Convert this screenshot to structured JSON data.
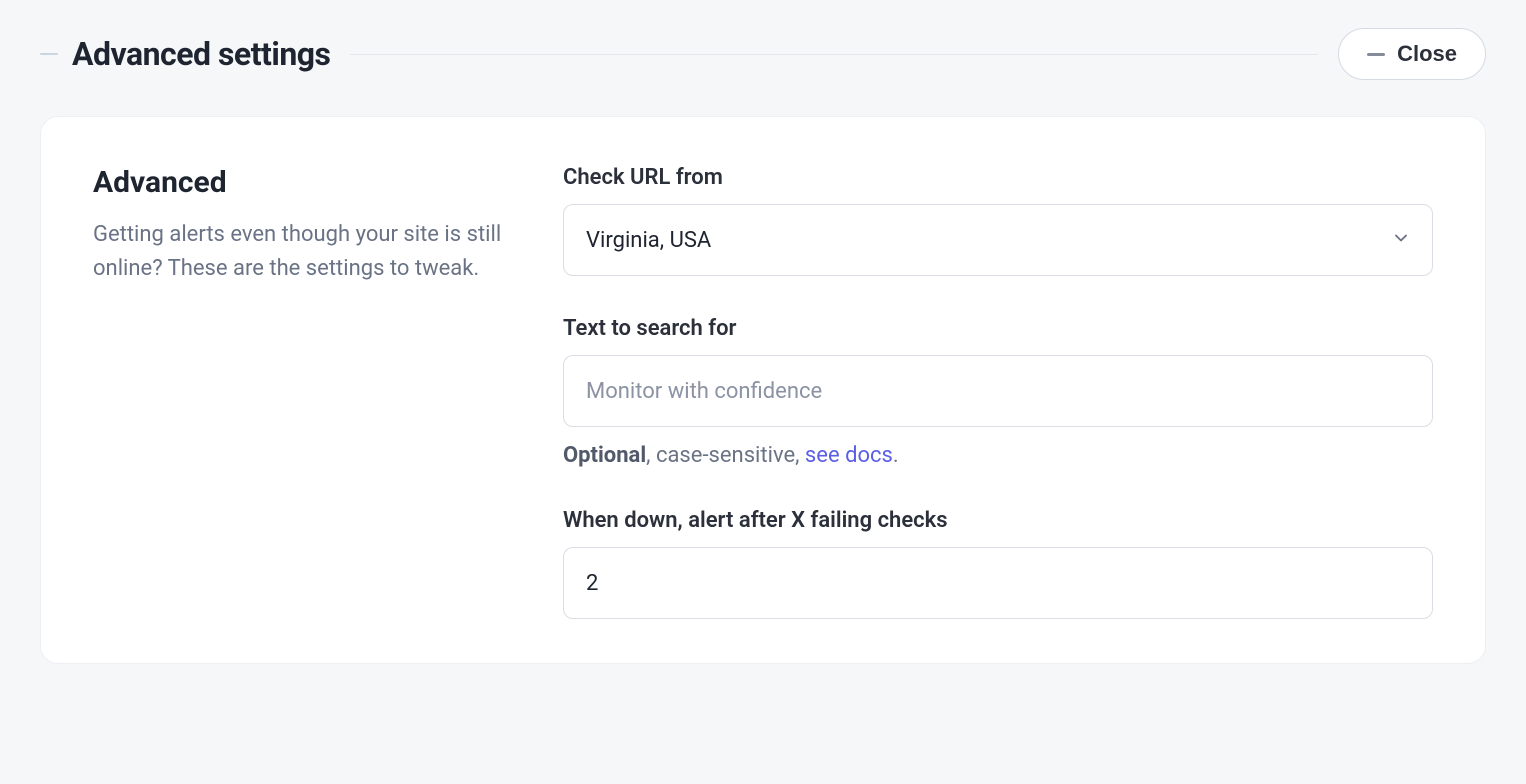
{
  "section": {
    "title": "Advanced settings",
    "close_label": "Close"
  },
  "advanced": {
    "title": "Advanced",
    "description": "Getting alerts even though your site is still online? These are the settings to tweak."
  },
  "fields": {
    "check_url": {
      "label": "Check URL from",
      "value": "Virginia, USA"
    },
    "text_search": {
      "label": "Text to search for",
      "placeholder": "Monitor with confidence",
      "help_strong": "Optional",
      "help_text": ", case-sensitive, ",
      "help_link": "see docs",
      "help_suffix": "."
    },
    "alert_after": {
      "label": "When down, alert after X failing checks",
      "value": "2"
    }
  }
}
